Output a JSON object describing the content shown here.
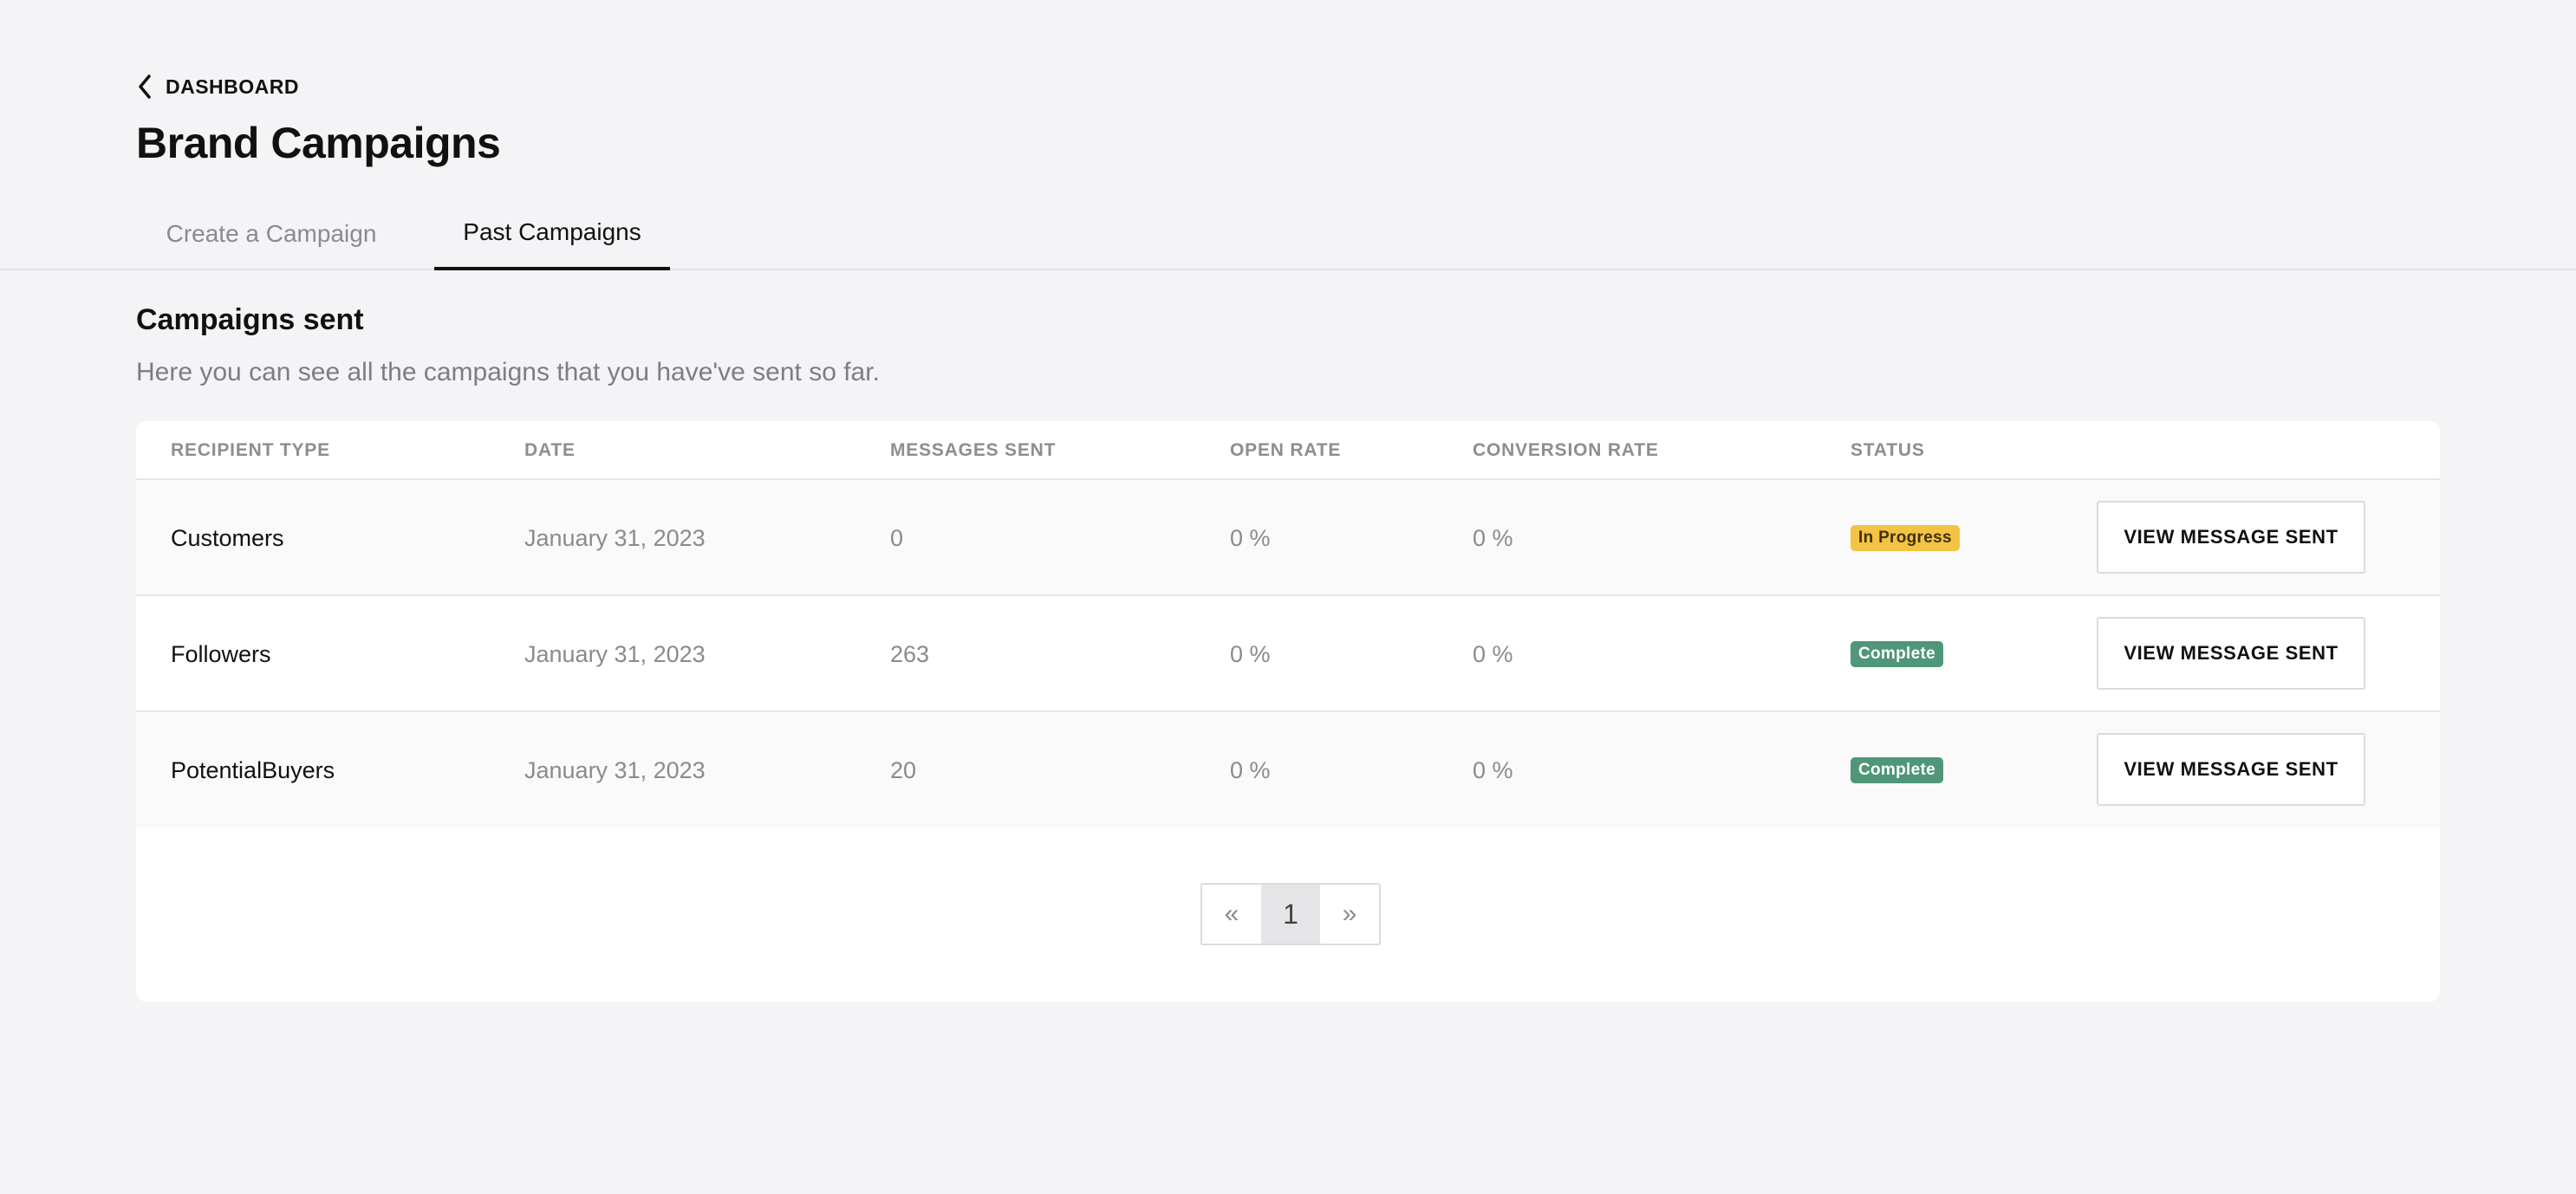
{
  "nav": {
    "back_label": "DASHBOARD"
  },
  "page": {
    "title": "Brand Campaigns"
  },
  "tabs": [
    {
      "label": "Create a Campaign",
      "active": false
    },
    {
      "label": "Past Campaigns",
      "active": true
    }
  ],
  "section": {
    "title": "Campaigns sent",
    "description": "Here you can see all the campaigns that you have've sent so far."
  },
  "table": {
    "headers": {
      "recipient_type": "RECIPIENT TYPE",
      "date": "DATE",
      "messages_sent": "MESSAGES SENT",
      "open_rate": "OPEN RATE",
      "conversion_rate": "CONVERSION RATE",
      "status": "STATUS"
    },
    "rows": [
      {
        "recipient_type": "Customers",
        "date": "January 31, 2023",
        "messages_sent": "0",
        "open_rate": "0 %",
        "conversion_rate": "0 %",
        "status": "In Progress",
        "action": "VIEW MESSAGE SENT"
      },
      {
        "recipient_type": "Followers",
        "date": "January 31, 2023",
        "messages_sent": "263",
        "open_rate": "0 %",
        "conversion_rate": "0 %",
        "status": "Complete",
        "action": "VIEW MESSAGE SENT"
      },
      {
        "recipient_type": "PotentialBuyers",
        "date": "January 31, 2023",
        "messages_sent": "20",
        "open_rate": "0 %",
        "conversion_rate": "0 %",
        "status": "Complete",
        "action": "VIEW MESSAGE SENT"
      }
    ]
  },
  "pagination": {
    "prev": "«",
    "current": "1",
    "next": "»"
  },
  "colors": {
    "background": "#f4f4f6",
    "status_in_progress": "#f5c343",
    "status_complete": "#4f9778",
    "active_tab_underline": "#111111"
  },
  "icons": {
    "back": "chevron-left-icon"
  }
}
